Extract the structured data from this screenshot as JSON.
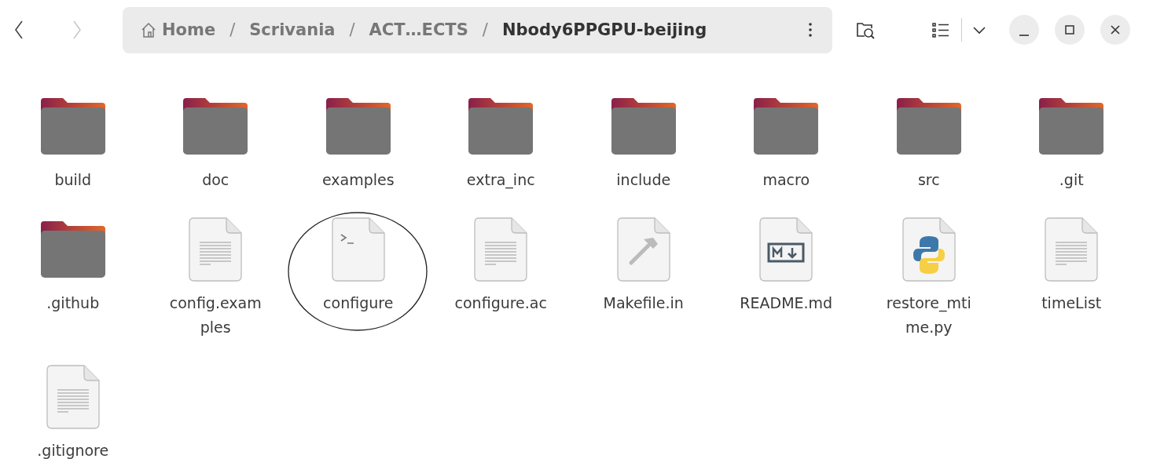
{
  "navigation": {
    "back": {
      "disabled": false
    },
    "forward": {
      "disabled": true
    }
  },
  "breadcrumb": [
    {
      "label": "Home",
      "kind": "home",
      "current": false
    },
    {
      "separator": "/",
      "label": "Scrivania",
      "kind": "folder",
      "current": false
    },
    {
      "separator": "/",
      "label": "ACT…ECTS",
      "kind": "folder",
      "current": false
    },
    {
      "separator": "/",
      "label": "Nbody6PPGPU-beijing",
      "kind": "folder",
      "current": true
    }
  ],
  "files": [
    {
      "name": "build",
      "kind": "folder",
      "circled": false
    },
    {
      "name": "doc",
      "kind": "folder",
      "circled": false
    },
    {
      "name": "examples",
      "kind": "folder",
      "circled": false
    },
    {
      "name": "extra_inc",
      "kind": "folder",
      "circled": false
    },
    {
      "name": "include",
      "kind": "folder",
      "circled": false
    },
    {
      "name": "macro",
      "kind": "folder",
      "circled": false
    },
    {
      "name": "src",
      "kind": "folder",
      "circled": false
    },
    {
      "name": ".git",
      "kind": "folder",
      "circled": false
    },
    {
      "name": ".github",
      "kind": "folder",
      "circled": false
    },
    {
      "name": "config.exam\nples",
      "kind": "text",
      "circled": false
    },
    {
      "name": "configure",
      "kind": "script",
      "circled": true
    },
    {
      "name": "configure.ac",
      "kind": "text",
      "circled": false
    },
    {
      "name": "Makefile.in",
      "kind": "make",
      "circled": false
    },
    {
      "name": "README.md",
      "kind": "markdown",
      "circled": false
    },
    {
      "name": "restore_mti\nme.py",
      "kind": "python",
      "circled": false
    },
    {
      "name": "timeList",
      "kind": "text",
      "circled": false
    },
    {
      "name": ".gitignore",
      "kind": "text",
      "circled": false
    }
  ]
}
